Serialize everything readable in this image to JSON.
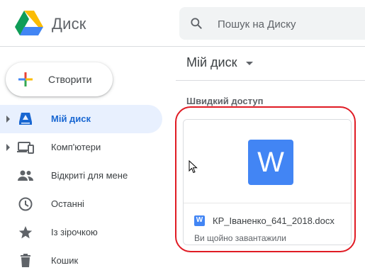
{
  "app": {
    "title": "Диск",
    "logo_icon": "google-drive-logo"
  },
  "search": {
    "placeholder": "Пошук на Диску",
    "value": ""
  },
  "create_button": {
    "label": "Створити"
  },
  "sidebar": {
    "items": [
      {
        "label": "Мій диск",
        "icon": "my-drive-icon",
        "active": true,
        "expandable": true
      },
      {
        "label": "Комп'ютери",
        "icon": "computers-icon",
        "active": false,
        "expandable": true
      },
      {
        "label": "Відкриті для мене",
        "icon": "shared-with-me-icon",
        "active": false,
        "expandable": false
      },
      {
        "label": "Останні",
        "icon": "clock-icon",
        "active": false,
        "expandable": false
      },
      {
        "label": "Із зірочкою",
        "icon": "star-icon",
        "active": false,
        "expandable": false
      },
      {
        "label": "Кошик",
        "icon": "trash-icon",
        "active": false,
        "expandable": false
      }
    ]
  },
  "main": {
    "title": "Мій диск",
    "quick_access_label": "Швидкий доступ",
    "files": [
      {
        "name": "КР_Іваненко_641_2018.docx",
        "meta": "Ви щойно завантажили",
        "icon_letter": "W"
      }
    ]
  },
  "colors": {
    "accent_blue": "#1967d2",
    "active_bg": "#e8f0fe",
    "word_blue": "#4285f4",
    "highlight_red": "#e01b24"
  }
}
